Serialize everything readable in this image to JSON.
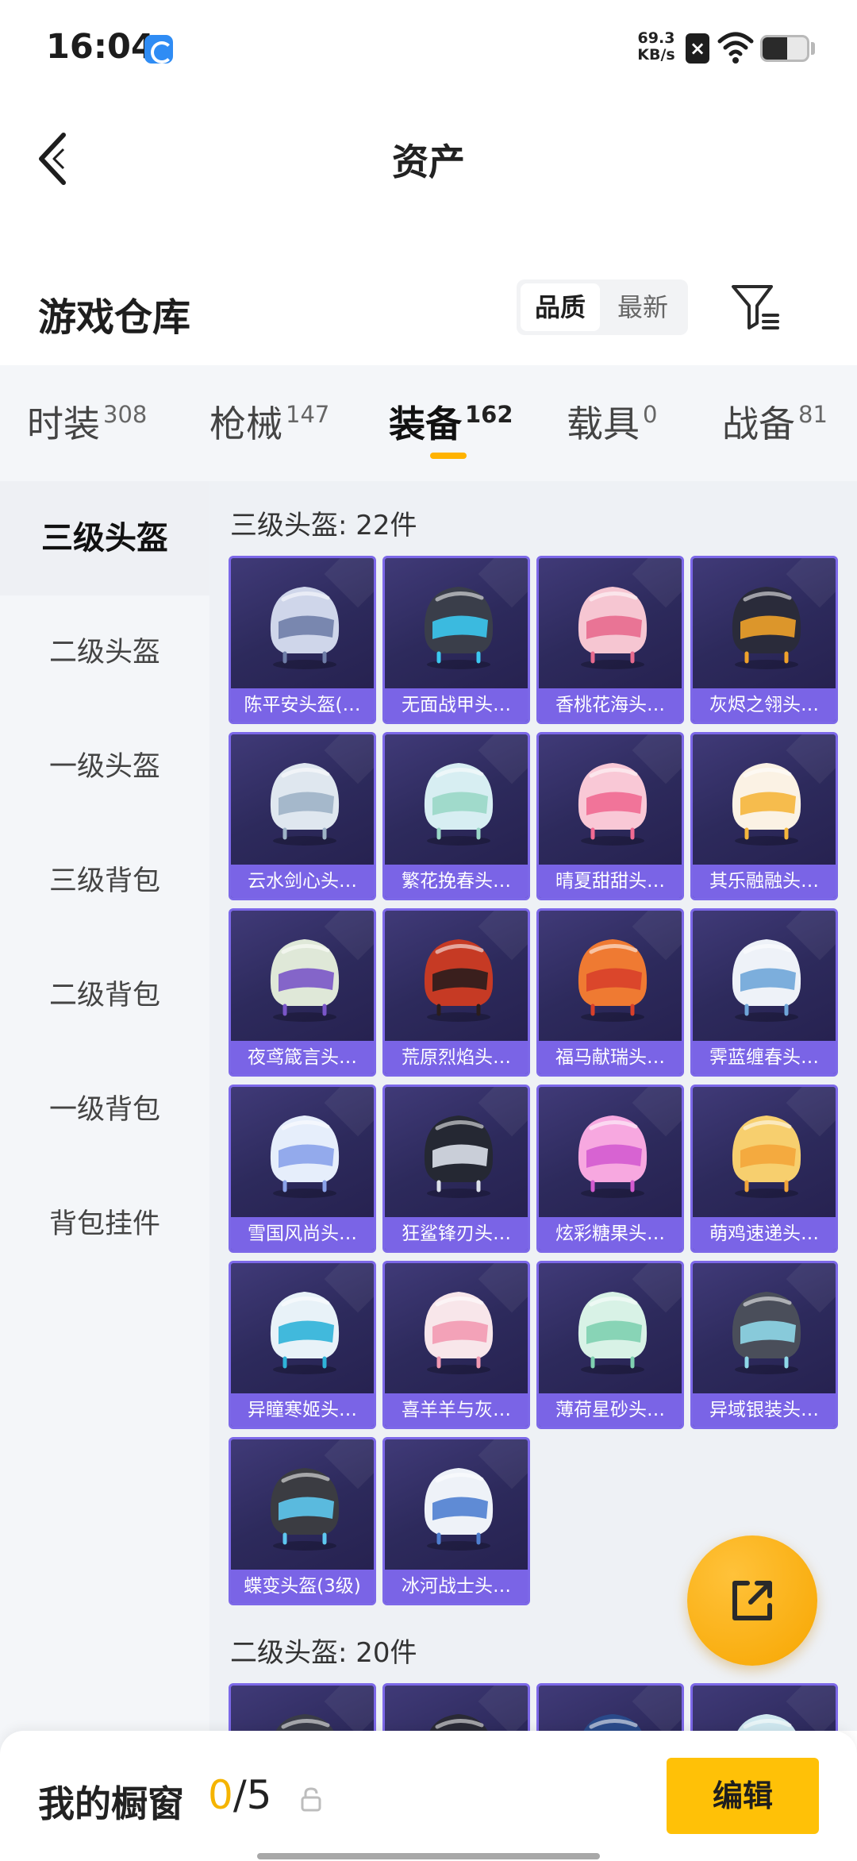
{
  "status_bar": {
    "time": "16:04",
    "net_speed_value": "69.3",
    "net_speed_unit": "KB/s",
    "battery_level": 0.55
  },
  "nav": {
    "title": "资产"
  },
  "warehouse": {
    "title": "游戏仓库",
    "sort_options": [
      "品质",
      "最新"
    ],
    "active_sort": "品质"
  },
  "tabs": [
    {
      "label": "时装",
      "count": "308"
    },
    {
      "label": "枪械",
      "count": "147"
    },
    {
      "label": "装备",
      "count": "162"
    },
    {
      "label": "载具",
      "count": "0"
    },
    {
      "label": "战备",
      "count": "81"
    }
  ],
  "active_tab": "装备",
  "sidebar": {
    "items": [
      "三级头盔",
      "二级头盔",
      "一级头盔",
      "三级背包",
      "二级背包",
      "一级背包",
      "背包挂件"
    ],
    "active": "三级头盔"
  },
  "groups": [
    {
      "title": "三级头盔: 22件",
      "items": [
        {
          "name": "陈平安头盔(…",
          "colors": [
            "#cfd6ea",
            "#6f7ea8"
          ]
        },
        {
          "name": "无面战甲头…",
          "colors": [
            "#3a3e4a",
            "#3cc8f0"
          ]
        },
        {
          "name": "香桃花海头…",
          "colors": [
            "#f6c6d2",
            "#e86a8e"
          ]
        },
        {
          "name": "灰烬之翎头…",
          "colors": [
            "#2a2b3a",
            "#f0a22a"
          ]
        },
        {
          "name": "云水剑心头…",
          "colors": [
            "#dfe7ef",
            "#9fb3c6"
          ]
        },
        {
          "name": "繁花挽春头…",
          "colors": [
            "#d7eef2",
            "#9ad7c7"
          ]
        },
        {
          "name": "晴夏甜甜头…",
          "colors": [
            "#f9c8d6",
            "#f06a92"
          ]
        },
        {
          "name": "其乐融融头…",
          "colors": [
            "#fbf2e4",
            "#f5b63c"
          ]
        },
        {
          "name": "夜鸢箴言头…",
          "colors": [
            "#dfe8d8",
            "#7a56c8"
          ]
        },
        {
          "name": "荒原烈焰头…",
          "colors": [
            "#c63a24",
            "#2a1d1d"
          ]
        },
        {
          "name": "福马献瑞头…",
          "colors": [
            "#ef7a32",
            "#d8402a"
          ]
        },
        {
          "name": "霁蓝缠春头…",
          "colors": [
            "#eef2f8",
            "#6fa6d8"
          ]
        },
        {
          "name": "雪国风尚头…",
          "colors": [
            "#e6eefb",
            "#8aa2ea"
          ]
        },
        {
          "name": "狂鲨锋刃头…",
          "colors": [
            "#252833",
            "#dbe0ea"
          ]
        },
        {
          "name": "炫彩糖果头…",
          "colors": [
            "#f7a8e0",
            "#d35bd0"
          ]
        },
        {
          "name": "萌鸡速递头…",
          "colors": [
            "#f7cf6e",
            "#f3a53a"
          ]
        },
        {
          "name": "异瞳寒姬头…",
          "colors": [
            "#e8f2f8",
            "#2fb3d8"
          ]
        },
        {
          "name": "喜羊羊与灰…",
          "colors": [
            "#f8e6ea",
            "#f29ab2"
          ]
        },
        {
          "name": "薄荷星砂头…",
          "colors": [
            "#d8f2e6",
            "#7fd0b0"
          ]
        },
        {
          "name": "异域银装头…",
          "colors": [
            "#4a4e5a",
            "#8fd8e8"
          ]
        },
        {
          "name": "蝶变头盔(3级)",
          "colors": [
            "#3b3c42",
            "#5ec8f0"
          ]
        },
        {
          "name": "冰河战士头…",
          "colors": [
            "#eef2f8",
            "#4f7fd0"
          ]
        }
      ]
    },
    {
      "title": "二级头盔: 20件",
      "items": [
        {
          "name": "",
          "colors": [
            "#3a3c48",
            "#8a8fa0"
          ]
        },
        {
          "name": "",
          "colors": [
            "#2a2a36",
            "#6a6f80"
          ]
        },
        {
          "name": "",
          "colors": [
            "#2a4a8a",
            "#4f7fd0"
          ]
        },
        {
          "name": "",
          "colors": [
            "#cfe8f0",
            "#7fc0d8"
          ]
        }
      ]
    }
  ],
  "fab": {
    "icon": "share-out-icon"
  },
  "showcase": {
    "title": "我的橱窗",
    "current": "0",
    "total": "/5",
    "edit_label": "编辑"
  },
  "colors": {
    "accent": "#ffc107",
    "card_border": "#7c68e8",
    "card_label_bg": "#7a64e6"
  }
}
